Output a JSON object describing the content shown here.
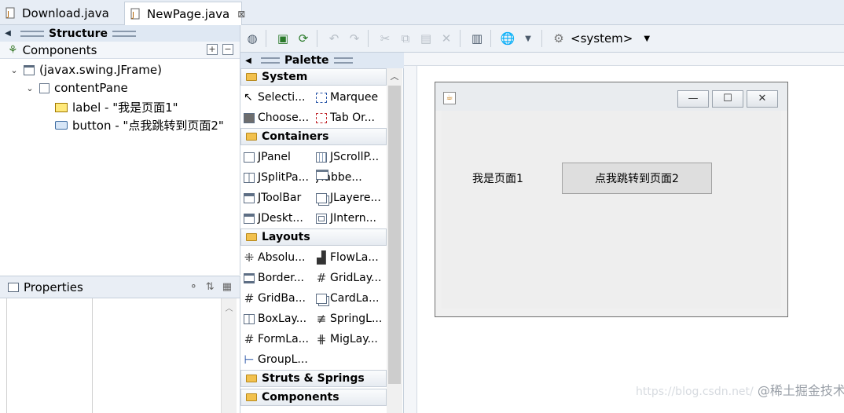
{
  "tabs": [
    {
      "label": "Download.java",
      "closable": false
    },
    {
      "label": "NewPage.java",
      "closable": true,
      "close_glyph": "⊠"
    }
  ],
  "structure": {
    "title": "Structure",
    "components_label": "Components",
    "tree": [
      {
        "label": "(javax.swing.JFrame)",
        "icon": "frame-icon"
      },
      {
        "label": "contentPane",
        "icon": "pane-icon"
      },
      {
        "label": "label - \"我是页面1\"",
        "icon": "label-icon"
      },
      {
        "label": "button - \"点我跳转到页面2\"",
        "icon": "button-icon"
      }
    ]
  },
  "properties": {
    "title": "Properties"
  },
  "toolbar": {
    "look_and_feel": "<system>"
  },
  "palette": {
    "title": "Palette",
    "categories": [
      {
        "name": "System",
        "items": [
          "Selecti...",
          "Marquee",
          "Choose...",
          "Tab Or..."
        ]
      },
      {
        "name": "Containers",
        "items": [
          "JPanel",
          "JScrollP...",
          "JSplitPa...",
          "JTabbe...",
          "JToolBar",
          "JLayere...",
          "JDeskt...",
          "JIntern..."
        ]
      },
      {
        "name": "Layouts",
        "items": [
          "Absolu...",
          "FlowLa...",
          "Border...",
          "GridLay...",
          "GridBa...",
          "CardLa...",
          "BoxLay...",
          "SpringL...",
          "FormLa...",
          "MigLay...",
          "GroupL..."
        ]
      },
      {
        "name": "Struts & Springs",
        "items": []
      },
      {
        "name": "Components",
        "items": []
      }
    ]
  },
  "design": {
    "label_text": "我是页面1",
    "button_text": "点我跳转到页面2"
  },
  "watermark": {
    "text": "@稀土掘金技术社区",
    "faint_text": "https://blog.csdn.net/"
  }
}
